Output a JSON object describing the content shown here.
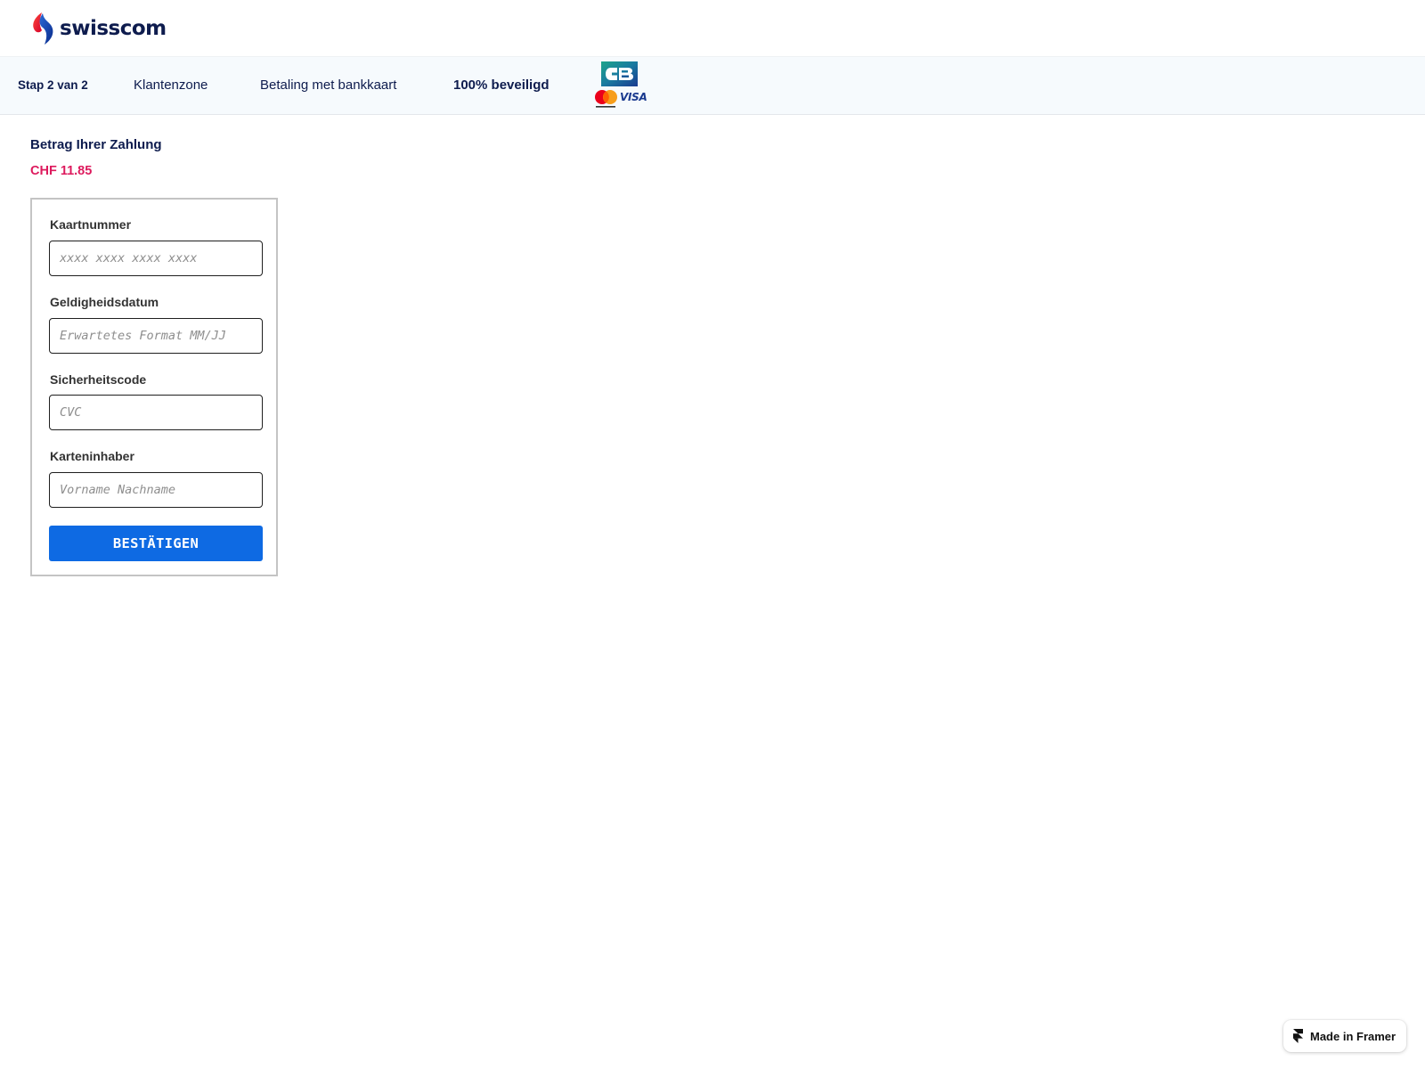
{
  "brand": {
    "name": "swisscom",
    "logo_icon": "swisscom-logo-icon"
  },
  "nav": {
    "step": "Stap 2 van 2",
    "customer_zone": "Klantenzone",
    "payment": "Betaling met bankkaart",
    "secure": "100% beveiligd",
    "card_logos": {
      "cb": "CB",
      "mastercard_icon": "mastercard-icon",
      "visa": "VISA"
    }
  },
  "payment": {
    "amount_label": "Betrag Ihrer Zahlung",
    "amount_value": "CHF 11.85"
  },
  "form": {
    "card_number": {
      "label": "Kaartnummer",
      "placeholder": "xxxx xxxx xxxx xxxx",
      "value": ""
    },
    "expiry": {
      "label": "Geldigheidsdatum",
      "placeholder": "Erwartetes Format MM/JJ",
      "value": ""
    },
    "cvc": {
      "label": "Sicherheitscode",
      "placeholder": "CVC",
      "value": ""
    },
    "holder": {
      "label": "Karteninhaber",
      "placeholder": "Vorname Nachname",
      "value": ""
    },
    "confirm_label": "BESTÄTIGEN"
  },
  "badge": {
    "text": "Made in Framer",
    "icon": "framer-icon"
  },
  "colors": {
    "brand_navy": "#0e1c4e",
    "amount_pink": "#dd1a5d",
    "button_blue": "#0e6ae3",
    "navbar_bg": "#f6fafd",
    "panel_border": "#c4c4c4"
  }
}
